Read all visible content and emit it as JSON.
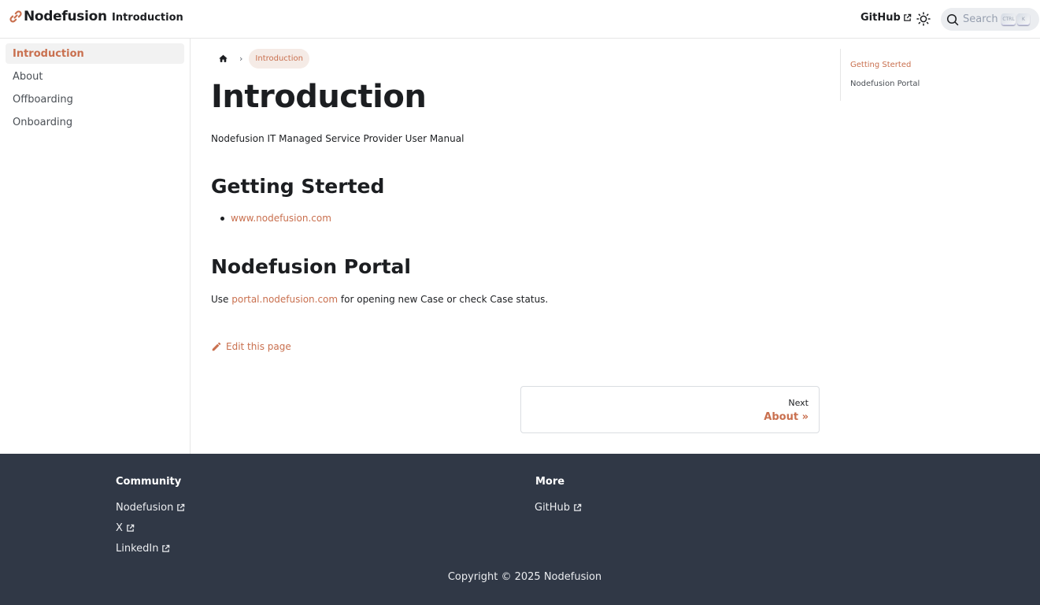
{
  "colors": {
    "primary": "#c9704f",
    "footer_bg": "#303846",
    "active_sidebar_bg": "#f2f2f2",
    "breadcrumb_bg": "#f5ebe6"
  },
  "navbar": {
    "brand_title": "Nodefusion",
    "brand_icon": "link-logo-icon",
    "nav_item": "Introduction",
    "github_label": "GitHub",
    "theme_toggle_icon": "sun-icon",
    "search": {
      "placeholder": "Search",
      "key_ctrl": "CTRL",
      "key_k": "K"
    }
  },
  "sidebar": {
    "items": [
      {
        "label": "Introduction",
        "active": true
      },
      {
        "label": "About",
        "active": false
      },
      {
        "label": "Offboarding",
        "active": false
      },
      {
        "label": "Onboarding",
        "active": false
      }
    ]
  },
  "breadcrumb": {
    "home_icon": "home-icon",
    "separator": "›",
    "current": "Introduction"
  },
  "main": {
    "title": "Introduction",
    "subtitle": "Nodefusion IT Managed Service Provider User Manual",
    "section1_heading": "Getting Sterted",
    "section1_link": "www.nodefusion.com",
    "section2_heading": "Nodefusion Portal",
    "section2_prefix": "Use ",
    "section2_link": "portal.nodefusion.com",
    "section2_suffix": " for opening new Case or check Case status.",
    "edit_label": "Edit this page"
  },
  "pager": {
    "sublabel": "Next",
    "label": "About »"
  },
  "toc": {
    "items": [
      {
        "label": "Getting Sterted",
        "active": true
      },
      {
        "label": "Nodefusion Portal",
        "active": false
      }
    ]
  },
  "footer": {
    "community_title": "Community",
    "community_links": [
      "Nodefusion",
      "X",
      "LinkedIn"
    ],
    "more_title": "More",
    "more_links": [
      "GitHub"
    ],
    "copyright": "Copyright © 2025 Nodefusion"
  }
}
